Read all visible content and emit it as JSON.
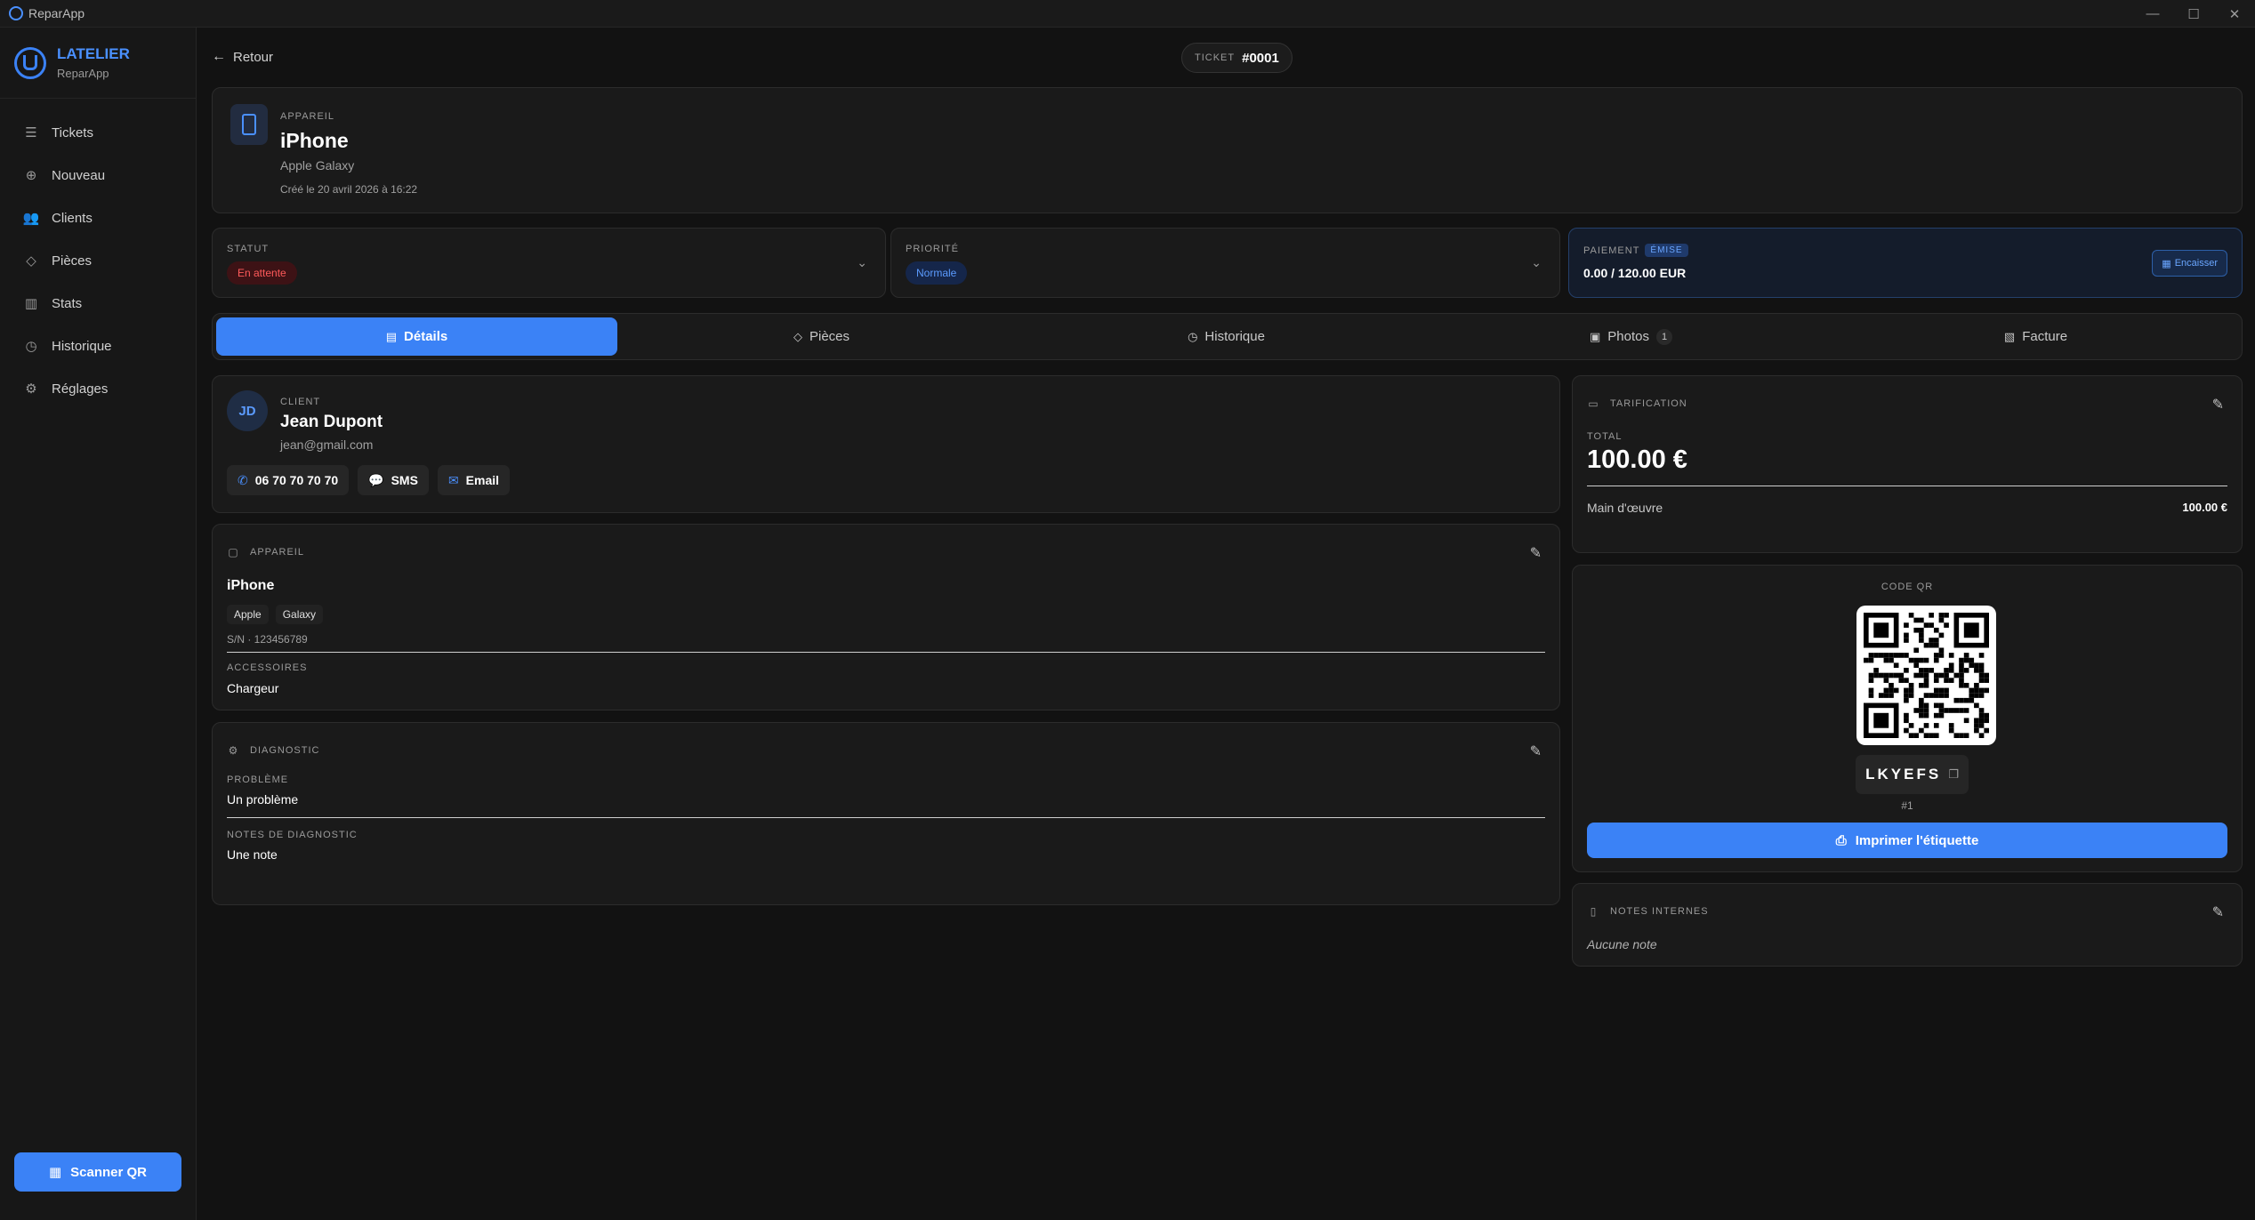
{
  "window": {
    "title": "ReparApp",
    "controls": [
      "—",
      "☐",
      "✕"
    ]
  },
  "brand": {
    "name": "LATELIER",
    "sub": "ReparApp"
  },
  "nav": [
    {
      "id": "tickets",
      "label": "Tickets",
      "icon": "list-icon"
    },
    {
      "id": "nouveau",
      "label": "Nouveau",
      "icon": "plus-circle-icon"
    },
    {
      "id": "clients",
      "label": "Clients",
      "icon": "users-icon"
    },
    {
      "id": "pieces",
      "label": "Pièces",
      "icon": "tag-icon"
    },
    {
      "id": "stats",
      "label": "Stats",
      "icon": "bar-chart-icon"
    },
    {
      "id": "historique",
      "label": "Historique",
      "icon": "clock-icon"
    },
    {
      "id": "reglages",
      "label": "Réglages",
      "icon": "gear-icon"
    }
  ],
  "scan_button": "Scanner QR",
  "topbar": {
    "back": "Retour",
    "ticket_label": "TICKET",
    "ticket_number": "#0001"
  },
  "device_header": {
    "label": "APPAREIL",
    "name": "iPhone",
    "model": "Apple Galaxy",
    "created": "Créé le 20 avril 2026 à 16:22"
  },
  "status": {
    "label": "STATUT",
    "value": "En attente"
  },
  "priority": {
    "label": "PRIORITÉ",
    "value": "Normale"
  },
  "payment": {
    "label": "PAIEMENT",
    "badge": "ÉMISE",
    "amount": "0.00 / 120.00 EUR",
    "action": "Encaisser"
  },
  "tabs": [
    {
      "label": "Détails",
      "active": true
    },
    {
      "label": "Pièces"
    },
    {
      "label": "Historique"
    },
    {
      "label": "Photos",
      "count": "1"
    },
    {
      "label": "Facture"
    }
  ],
  "client": {
    "label": "CLIENT",
    "initials": "JD",
    "name": "Jean Dupont",
    "email": "jean@gmail.com",
    "phone": "06 70 70 70 70",
    "sms": "SMS",
    "email_btn": "Email"
  },
  "appareil": {
    "label": "APPAREIL",
    "name": "iPhone",
    "brand": "Apple",
    "model": "Galaxy",
    "sn": "S/N · 123456789",
    "accessories_label": "ACCESSOIRES",
    "accessories": "Chargeur"
  },
  "diagnostic": {
    "label": "DIAGNOSTIC",
    "problem_label": "PROBLÈME",
    "problem": "Un problème",
    "notes_label": "NOTES DE DIAGNOSTIC",
    "notes": "Une note"
  },
  "pricing": {
    "label": "TARIFICATION",
    "total_label": "TOTAL",
    "total": "100.00 €",
    "line_label": "Main d'œuvre",
    "line_value": "100.00 €"
  },
  "qr": {
    "label": "CODE QR",
    "code": "LKYEFS",
    "index": "#1",
    "print": "Imprimer l'étiquette"
  },
  "notes": {
    "label": "NOTES INTERNES",
    "value": "Aucune note"
  }
}
